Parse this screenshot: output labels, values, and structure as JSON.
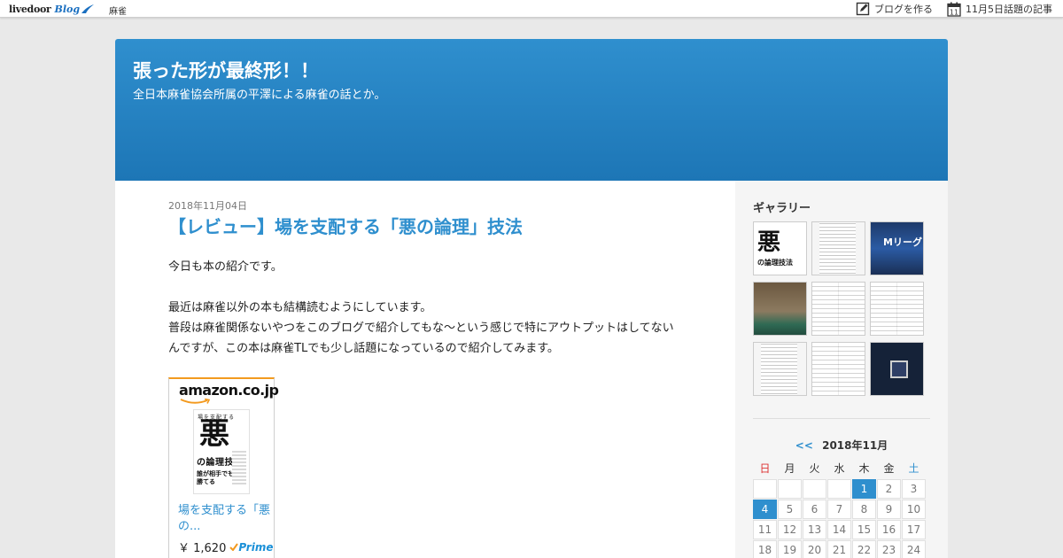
{
  "topbar": {
    "logo_word": "livedoor",
    "logo_blog": "Blog",
    "category": "麻雀",
    "create_blog": "ブログを作る",
    "calendar_day": "11",
    "trending": "11月5日話題の記事"
  },
  "header": {
    "title": "張った形が最終形！！",
    "description": "全日本麻雀協会所属の平澤による麻雀の話とか。"
  },
  "post": {
    "date": "2018年11月04日",
    "title": "【レビュー】場を支配する「悪の論理」技法",
    "paragraphs": [
      "今日も本の紹介です。",
      "最近は麻雀以外の本も結構読むようにしています。\n普段は麻雀関係ないやつをこのブログで紹介してもな〜という感じで特にアウトプットはしてないんですが、この本は麻雀TLでも少し話題になっているので紹介してみます。"
    ]
  },
  "amazon": {
    "logo": "amazon.co.jp",
    "book_top": "場を支配する",
    "book_big": "悪",
    "book_sub": "の論理技法",
    "book_foot": "誰が相手でも必ず勝てる",
    "link": "場を支配する「悪の...",
    "price": "￥ 1,620",
    "prime": "Prime"
  },
  "sidebar": {
    "gallery_heading": "ギャラリー",
    "gallery_m_text": "Mリーグ",
    "calendar": {
      "prev": "<<",
      "month": "2018年11月",
      "weekdays": [
        "日",
        "月",
        "火",
        "水",
        "木",
        "金",
        "土"
      ],
      "days": [
        "",
        "",
        "",
        "",
        "1",
        "2",
        "3",
        "4",
        "5",
        "6",
        "7",
        "8",
        "9",
        "10",
        "11",
        "12",
        "13",
        "14",
        "15",
        "16",
        "17",
        "18",
        "19",
        "20",
        "21",
        "22",
        "23",
        "24"
      ],
      "active_days": [
        "1",
        "4"
      ]
    }
  },
  "colors": {
    "accent": "#2f8fce",
    "header_top": "#2f8fce",
    "header_bottom": "#1d76b6",
    "amazon_orange": "#f39a1f",
    "sunday": "#d33333"
  }
}
